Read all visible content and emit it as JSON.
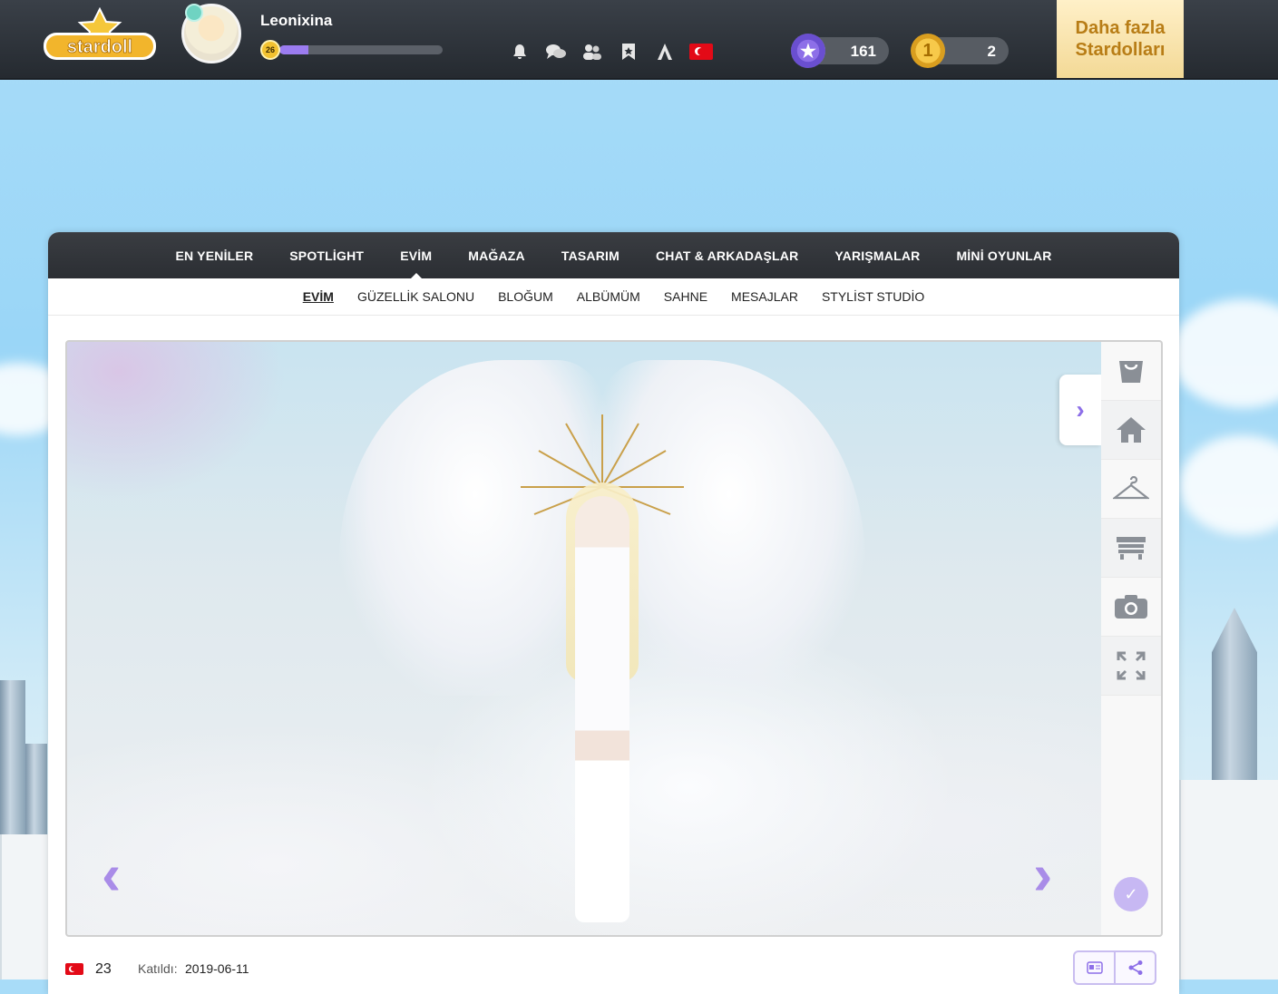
{
  "header": {
    "logo_text": "stardoll",
    "username": "Leonixina",
    "level": "26",
    "xp_progress": 0.18,
    "icons": [
      "bell-icon",
      "chat-bubbles-icon",
      "friends-icon",
      "bookmark-icon",
      "a-letter-icon",
      "turkey-flag-icon"
    ],
    "stardollars": "161",
    "coins": "2",
    "coin_glyph": "1",
    "more_button": "Daha fazla Stardolları"
  },
  "main_nav": {
    "items": [
      "EN YENİLER",
      "SPOTLİGHT",
      "EVİM",
      "MAĞAZA",
      "TASARIM",
      "CHAT & ARKADAŞLAR",
      "YARIŞMALAR",
      "MİNİ OYUNLAR"
    ],
    "active": "EVİM"
  },
  "sub_nav": {
    "items": [
      "EVİM",
      "GÜZELLİK SALONU",
      "BLOĞUM",
      "ALBÜMÜM",
      "SAHNE",
      "MESAJLAR",
      "STYLİST STUDİO"
    ],
    "active": "EVİM"
  },
  "stage": {
    "prev_arrow": "‹",
    "next_arrow": "›",
    "expand_arrow": "›",
    "tools": [
      "shopping-bag-icon",
      "home-icon",
      "hanger-icon",
      "furniture-icon",
      "camera-icon",
      "fullscreen-icon"
    ],
    "check_glyph": "✓"
  },
  "footer": {
    "age": "23",
    "joined_label": "Katıldı:",
    "joined_date": "2019-06-11"
  },
  "colors": {
    "accent": "#8d6fe8",
    "topbar": "#2b3036",
    "gold": "#b87d16"
  }
}
